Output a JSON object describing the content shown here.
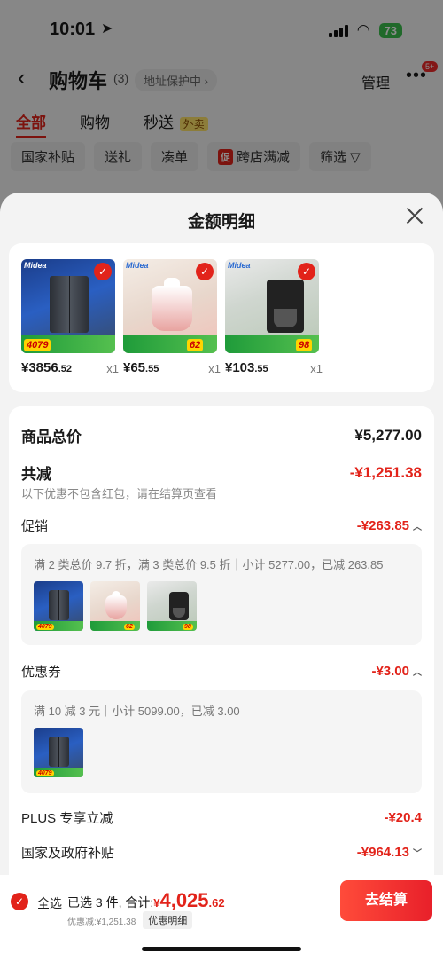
{
  "status_bar": {
    "time": "10:01",
    "battery": "73"
  },
  "cart_header": {
    "title": "购物车",
    "count": "(3)",
    "address_chip": "地址保护中",
    "manage": "管理",
    "message_badge": "5+"
  },
  "cart_tabs": [
    {
      "label": "全部"
    },
    {
      "label": "购物"
    },
    {
      "label": "秒送",
      "tag": "外卖"
    }
  ],
  "filter_chips": [
    {
      "label": "国家补贴"
    },
    {
      "label": "送礼"
    },
    {
      "label": "凑单"
    },
    {
      "label": "跨店满减",
      "icon_text": "促"
    },
    {
      "label": "筛选"
    }
  ],
  "sheet": {
    "title": "金额明细",
    "products": [
      {
        "price_int": "¥3856",
        "price_dec": ".52",
        "qty": "x1",
        "brand": "Midea",
        "promo": "4079"
      },
      {
        "price_int": "¥65",
        "price_dec": ".55",
        "qty": "x1",
        "brand": "Midea",
        "promo": "62"
      },
      {
        "price_int": "¥103",
        "price_dec": ".55",
        "qty": "x1",
        "brand": "Midea",
        "promo": "98"
      }
    ],
    "total_label": "商品总价",
    "total_value": "¥5,277.00",
    "reduce_label": "共减",
    "reduce_value": "-¥1,251.38",
    "reduce_note": "以下优惠不包含红包，请在结算页查看",
    "promo_label": "促销",
    "promo_value": "-¥263.85",
    "promo_detail": "满 2 类总价 9.7 折，满 3 类总价 9.5 折｜小计 5277.00，已减 263.85",
    "coupon_label": "优惠券",
    "coupon_value": "-¥3.00",
    "coupon_detail": "满 10 减 3 元｜小计 5099.00，已减 3.00",
    "plus_label": "PLUS 专享立减",
    "plus_value": "-¥20.4",
    "subsidy_label": "国家及政府补贴",
    "subsidy_value": "-¥964.13"
  },
  "bottom_bar": {
    "select_all": "全选",
    "selected_text": "已选 3 件, 合计:",
    "total_symbol": "¥",
    "total_int": "4,025",
    "total_dec": ".62",
    "saving_text": "优惠减:¥1,251.38",
    "detail_chip": "优惠明细",
    "checkout": "去结算"
  }
}
